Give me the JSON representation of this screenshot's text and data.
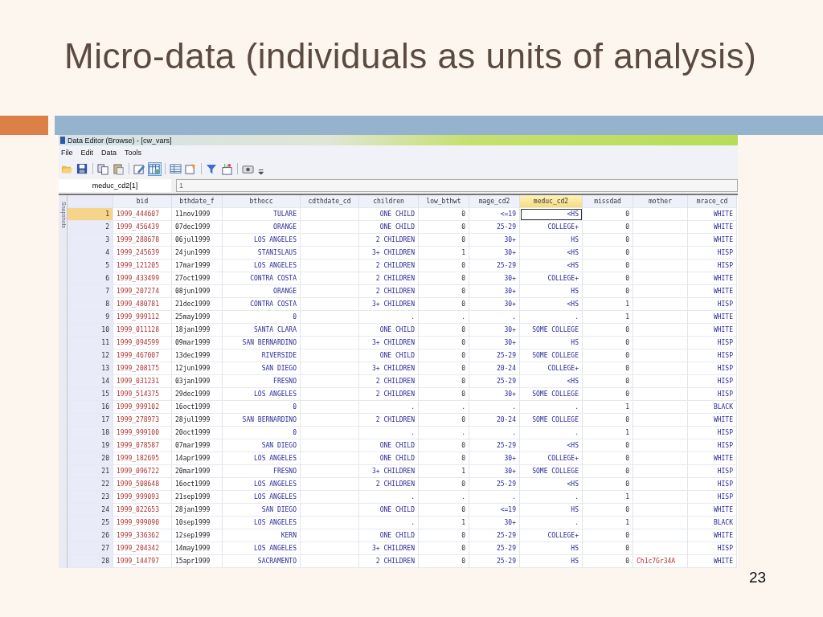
{
  "slide": {
    "title": "Micro-data (individuals as units of analysis)",
    "page_number": "23"
  },
  "window": {
    "title": "Data Editor (Browse) - [cw_vars]"
  },
  "menu": [
    "File",
    "Edit",
    "Data",
    "Tools"
  ],
  "toolbar": [
    {
      "kind": "open",
      "selected": false
    },
    {
      "kind": "save",
      "selected": false
    },
    {
      "kind": "sep"
    },
    {
      "kind": "copy",
      "selected": false
    },
    {
      "kind": "paste",
      "selected": false
    },
    {
      "kind": "sep"
    },
    {
      "kind": "edit",
      "selected": false
    },
    {
      "kind": "browse",
      "selected": true
    },
    {
      "kind": "sep"
    },
    {
      "kind": "grid",
      "selected": false
    },
    {
      "kind": "properties",
      "selected": false
    },
    {
      "kind": "sep"
    },
    {
      "kind": "filter",
      "selected": false
    },
    {
      "kind": "variables",
      "selected": false
    },
    {
      "kind": "sep"
    },
    {
      "kind": "snapshot",
      "selected": false
    },
    {
      "kind": "more",
      "selected": false
    }
  ],
  "cell_bar": {
    "name": "meduc_cd2[1]",
    "value": "1"
  },
  "side_tab": "Snapshots",
  "table": {
    "columns": [
      {
        "name": "bid",
        "kind": "string",
        "selected": false
      },
      {
        "name": "bthdate_f",
        "kind": "date",
        "selected": false
      },
      {
        "name": "bthocc",
        "kind": "labeled",
        "selected": false
      },
      {
        "name": "cdthdate_cd",
        "kind": "labeled",
        "selected": false
      },
      {
        "name": "children",
        "kind": "labeled",
        "selected": false
      },
      {
        "name": "low_bthwt",
        "kind": "number",
        "selected": false
      },
      {
        "name": "mage_cd2",
        "kind": "labeled",
        "selected": false
      },
      {
        "name": "meduc_cd2",
        "kind": "labeled",
        "selected": true
      },
      {
        "name": "missdad",
        "kind": "number",
        "selected": false
      },
      {
        "name": "mother",
        "kind": "string",
        "selected": false
      },
      {
        "name": "mrace_cd",
        "kind": "labeled",
        "selected": false
      }
    ],
    "rows": [
      {
        "number": "1",
        "selected": true,
        "cells": [
          "1999_444607",
          "11nov1999",
          "TULARE",
          null,
          "ONE CHILD",
          "0",
          "<=19",
          "<HS",
          "0",
          null,
          "WHITE"
        ]
      },
      {
        "number": "2",
        "selected": false,
        "cells": [
          "1999_456439",
          "07dec1999",
          "ORANGE",
          null,
          "ONE CHILD",
          "0",
          "25-29",
          "COLLEGE+",
          "0",
          null,
          "WHITE"
        ]
      },
      {
        "number": "3",
        "selected": false,
        "cells": [
          "1999_288678",
          "06jul1999",
          "LOS ANGELES",
          null,
          "2 CHILDREN",
          "0",
          "30+",
          "HS",
          "0",
          null,
          "WHITE"
        ]
      },
      {
        "number": "4",
        "selected": false,
        "cells": [
          "1999_245639",
          "24jun1999",
          "STANISLAUS",
          null,
          "3+ CHILDREN",
          "1",
          "30+",
          "<HS",
          "0",
          null,
          "HISP"
        ]
      },
      {
        "number": "5",
        "selected": false,
        "cells": [
          "1999_121205",
          "17mar1999",
          "LOS ANGELES",
          null,
          "2 CHILDREN",
          "0",
          "25-29",
          "<HS",
          "0",
          null,
          "HISP"
        ]
      },
      {
        "number": "6",
        "selected": false,
        "cells": [
          "1999_433499",
          "27oct1999",
          "CONTRA COSTA",
          null,
          "2 CHILDREN",
          "0",
          "30+",
          "COLLEGE+",
          "0",
          null,
          "WHITE"
        ]
      },
      {
        "number": "7",
        "selected": false,
        "cells": [
          "1999_207274",
          "08jun1999",
          "ORANGE",
          null,
          "2 CHILDREN",
          "0",
          "30+",
          "HS",
          "0",
          null,
          "WHITE"
        ]
      },
      {
        "number": "8",
        "selected": false,
        "cells": [
          "1999_480781",
          "21dec1999",
          "CONTRA COSTA",
          null,
          "3+ CHILDREN",
          "0",
          "30+",
          "<HS",
          "1",
          null,
          "HISP"
        ]
      },
      {
        "number": "9",
        "selected": false,
        "cells": [
          "1999_999112",
          "25may1999",
          "0",
          null,
          ".",
          ".",
          ".",
          ".",
          "1",
          null,
          "WHITE"
        ]
      },
      {
        "number": "10",
        "selected": false,
        "cells": [
          "1999_011128",
          "18jan1999",
          "SANTA CLARA",
          null,
          "ONE CHILD",
          "0",
          "30+",
          "SOME COLLEGE",
          "0",
          null,
          "WHITE"
        ]
      },
      {
        "number": "11",
        "selected": false,
        "cells": [
          "1999_094599",
          "09mar1999",
          "SAN BERNARDINO",
          null,
          "3+ CHILDREN",
          "0",
          "30+",
          "HS",
          "0",
          null,
          "HISP"
        ]
      },
      {
        "number": "12",
        "selected": false,
        "cells": [
          "1999_467007",
          "13dec1999",
          "RIVERSIDE",
          null,
          "ONE CHILD",
          "0",
          "25-29",
          "SOME COLLEGE",
          "0",
          null,
          "HISP"
        ]
      },
      {
        "number": "13",
        "selected": false,
        "cells": [
          "1999_208175",
          "12jun1999",
          "SAN DIEGO",
          null,
          "3+ CHILDREN",
          "0",
          "20-24",
          "COLLEGE+",
          "0",
          null,
          "HISP"
        ]
      },
      {
        "number": "14",
        "selected": false,
        "cells": [
          "1999_031231",
          "03jan1999",
          "FRESNO",
          null,
          "2 CHILDREN",
          "0",
          "25-29",
          "<HS",
          "0",
          null,
          "HISP"
        ]
      },
      {
        "number": "15",
        "selected": false,
        "cells": [
          "1999_514375",
          "29dec1999",
          "LOS ANGELES",
          null,
          "2 CHILDREN",
          "0",
          "30+",
          "SOME COLLEGE",
          "0",
          null,
          "HISP"
        ]
      },
      {
        "number": "16",
        "selected": false,
        "cells": [
          "1999_999102",
          "16oct1999",
          "0",
          null,
          ".",
          ".",
          ".",
          ".",
          "1",
          null,
          "BLACK"
        ]
      },
      {
        "number": "17",
        "selected": false,
        "cells": [
          "1999_278973",
          "28jul1999",
          "SAN BERNARDINO",
          null,
          "2 CHILDREN",
          "0",
          "20-24",
          "SOME COLLEGE",
          "0",
          null,
          "WHITE"
        ]
      },
      {
        "number": "18",
        "selected": false,
        "cells": [
          "1999_999100",
          "20oct1999",
          "0",
          null,
          ".",
          ".",
          ".",
          ".",
          "1",
          null,
          "HISP"
        ]
      },
      {
        "number": "19",
        "selected": false,
        "cells": [
          "1999_078587",
          "07mar1999",
          "SAN DIEGO",
          null,
          "ONE CHILD",
          "0",
          "25-29",
          "<HS",
          "0",
          null,
          "HISP"
        ]
      },
      {
        "number": "20",
        "selected": false,
        "cells": [
          "1999_182695",
          "14apr1999",
          "LOS ANGELES",
          null,
          "ONE CHILD",
          "0",
          "30+",
          "COLLEGE+",
          "0",
          null,
          "WHITE"
        ]
      },
      {
        "number": "21",
        "selected": false,
        "cells": [
          "1999_096722",
          "20mar1999",
          "FRESNO",
          null,
          "3+ CHILDREN",
          "1",
          "30+",
          "SOME COLLEGE",
          "0",
          null,
          "HISP"
        ]
      },
      {
        "number": "22",
        "selected": false,
        "cells": [
          "1999_508648",
          "16oct1999",
          "LOS ANGELES",
          null,
          "2 CHILDREN",
          "0",
          "25-29",
          "<HS",
          "0",
          null,
          "HISP"
        ]
      },
      {
        "number": "23",
        "selected": false,
        "cells": [
          "1999_999093",
          "21sep1999",
          "LOS ANGELES",
          null,
          ".",
          ".",
          ".",
          ".",
          "1",
          null,
          "HISP"
        ]
      },
      {
        "number": "24",
        "selected": false,
        "cells": [
          "1999_022653",
          "28jan1999",
          "SAN DIEGO",
          null,
          "ONE CHILD",
          "0",
          "<=19",
          "HS",
          "0",
          null,
          "WHITE"
        ]
      },
      {
        "number": "25",
        "selected": false,
        "cells": [
          "1999_999090",
          "10sep1999",
          "LOS ANGELES",
          null,
          ".",
          "1",
          "30+",
          ".",
          "1",
          null,
          "BLACK"
        ]
      },
      {
        "number": "26",
        "selected": false,
        "cells": [
          "1999_336362",
          "12sep1999",
          "KERN",
          null,
          "ONE CHILD",
          "0",
          "25-29",
          "COLLEGE+",
          "0",
          null,
          "WHITE"
        ]
      },
      {
        "number": "27",
        "selected": false,
        "cells": [
          "1999_204342",
          "14may1999",
          "LOS ANGELES",
          null,
          "3+ CHILDREN",
          "0",
          "25-29",
          "HS",
          "0",
          null,
          "HISP"
        ]
      },
      {
        "number": "28",
        "selected": false,
        "cells": [
          "1999_144797",
          "15apr1999",
          "SACRAMENTO",
          null,
          "2 CHILDREN",
          "0",
          "25-29",
          "HS",
          "0",
          "Ch1c7Gr34A",
          "WHITE"
        ]
      }
    ]
  }
}
